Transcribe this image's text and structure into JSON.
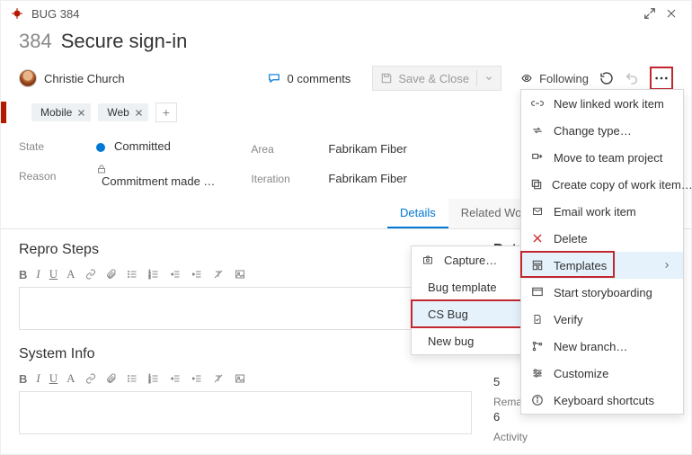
{
  "titlebar": {
    "type_label": "BUG",
    "id": "384"
  },
  "header": {
    "id": "384",
    "title": "Secure sign-in"
  },
  "assigned_to": "Christie Church",
  "comments": {
    "count": "0",
    "label": "comments"
  },
  "save_close": "Save & Close",
  "following": "Following",
  "tags": [
    "Mobile",
    "Web"
  ],
  "fields": {
    "state_label": "State",
    "state": "Committed",
    "reason_label": "Reason",
    "reason": "Commitment made …",
    "area_label": "Area",
    "area": "Fabrikam Fiber",
    "iteration_label": "Iteration",
    "iteration": "Fabrikam Fiber"
  },
  "tabs": {
    "details": "Details",
    "related": "Related Work item"
  },
  "sections": {
    "repro": "Repro Steps",
    "system": "System Info",
    "details": "Details"
  },
  "details_panel": {
    "val1": "5",
    "remaining_label": "Remaining Work",
    "val2": "6",
    "activity_label": "Activity"
  },
  "main_menu": {
    "new_linked": "New linked work item",
    "change_type": "Change type…",
    "move": "Move to team project",
    "create_copy": "Create copy of work item…",
    "email": "Email work item",
    "delete": "Delete",
    "templates": "Templates",
    "storyboard": "Start storyboarding",
    "verify": "Verify",
    "new_branch": "New branch…",
    "customize": "Customize",
    "shortcuts": "Keyboard shortcuts"
  },
  "sub_menu": {
    "capture": "Capture…",
    "bug_template": "Bug template",
    "cs_bug": "CS Bug",
    "new_bug": "New bug"
  }
}
